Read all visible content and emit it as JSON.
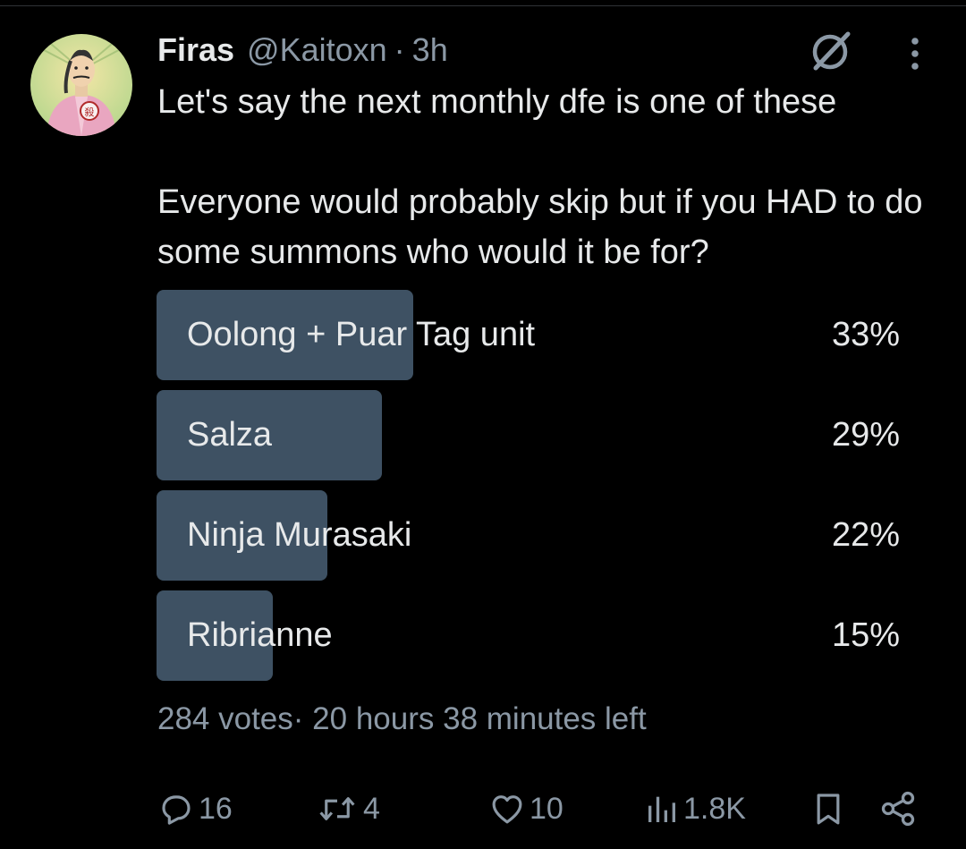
{
  "tweet": {
    "author_name": "Firas",
    "handle": "@Kaitoxn",
    "separator": "·",
    "time": "3h",
    "text": "Let's say the next monthly dfe is one of these\n\nEveryone would probably skip but if you HAD to do some summons who would it be for?"
  },
  "poll": {
    "options": [
      {
        "label": "Oolong + Puar Tag unit",
        "percent_text": "33%",
        "percent": 33
      },
      {
        "label": "Salza",
        "percent_text": "29%",
        "percent": 29
      },
      {
        "label": "Ninja Murasaki",
        "percent_text": "22%",
        "percent": 22
      },
      {
        "label": "Ribrianne",
        "percent_text": "15%",
        "percent": 15
      }
    ],
    "votes": "284 votes",
    "meta_separator": "·",
    "time_left": "20 hours 38 minutes left"
  },
  "actions": {
    "replies": "16",
    "reposts": "4",
    "likes": "10",
    "views": "1.8K"
  },
  "colors": {
    "background": "#000000",
    "text": "#e7e9ea",
    "secondary_text": "#8b98a5",
    "poll_bar": "#3e5163"
  },
  "icons": [
    "avatar",
    "grok-icon",
    "more-icon",
    "reply-icon",
    "repost-icon",
    "like-icon",
    "views-icon",
    "bookmark-icon",
    "share-icon"
  ]
}
